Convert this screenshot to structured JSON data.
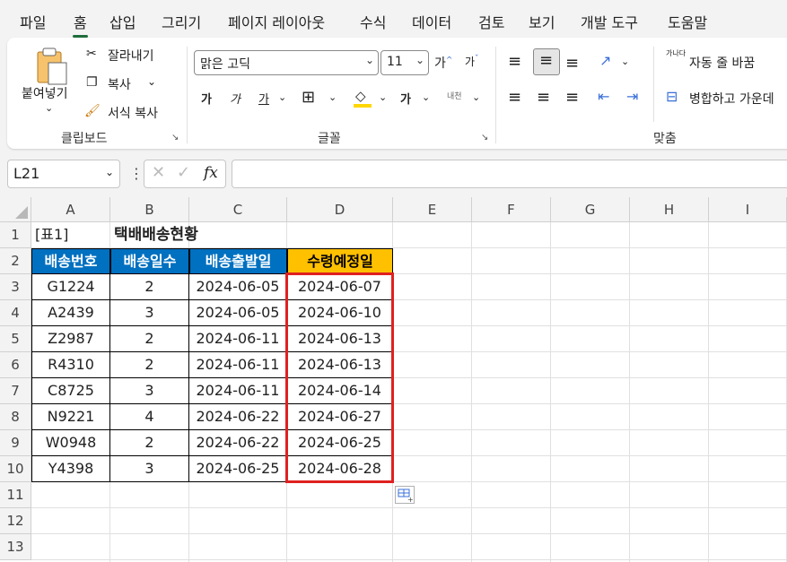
{
  "menu": [
    "파일",
    "홈",
    "삽입",
    "그리기",
    "페이지 레이아웃",
    "수식",
    "데이터",
    "검토",
    "보기",
    "개발 도구",
    "도움말"
  ],
  "ribbon": {
    "clipboard": {
      "paste": "붙여넣기",
      "cut": "잘라내기",
      "copy": "복사",
      "format_painter": "서식 복사",
      "label": "클립보드"
    },
    "font": {
      "name": "맑은 고딕",
      "size": "11",
      "label": "글꼴",
      "bold": "가",
      "italic": "가",
      "underline": "가",
      "phonetic": "내천"
    },
    "align": {
      "wrap": "자동 줄 바꿈",
      "merge": "병합하고 가운데",
      "label": "맞춤",
      "wrap_icon_text": "가나다"
    }
  },
  "namebox": "L21",
  "fx": "fx",
  "columns": [
    "A",
    "B",
    "C",
    "D",
    "E",
    "F",
    "G",
    "H",
    "I"
  ],
  "rows": [
    "1",
    "2",
    "3",
    "4",
    "5",
    "6",
    "7",
    "8",
    "9",
    "10",
    "11",
    "12",
    "13"
  ],
  "sheet": {
    "A1": "[표1]",
    "B1": "택배배송현황",
    "headers": [
      "배송번호",
      "배송일수",
      "배송출발일",
      "수령예정일"
    ],
    "data": [
      [
        "G1224",
        "2",
        "2024-06-05",
        "2024-06-07"
      ],
      [
        "A2439",
        "3",
        "2024-06-05",
        "2024-06-10"
      ],
      [
        "Z2987",
        "2",
        "2024-06-11",
        "2024-06-13"
      ],
      [
        "R4310",
        "2",
        "2024-06-11",
        "2024-06-13"
      ],
      [
        "C8725",
        "3",
        "2024-06-11",
        "2024-06-14"
      ],
      [
        "N9221",
        "4",
        "2024-06-22",
        "2024-06-27"
      ],
      [
        "W0948",
        "2",
        "2024-06-22",
        "2024-06-25"
      ],
      [
        "Y4398",
        "3",
        "2024-06-25",
        "2024-06-28"
      ]
    ]
  },
  "colors": {
    "header_blue": "#0070c0",
    "header_gold": "#ffc000",
    "highlight": "#e02020",
    "accent": "#1e6e3c"
  }
}
